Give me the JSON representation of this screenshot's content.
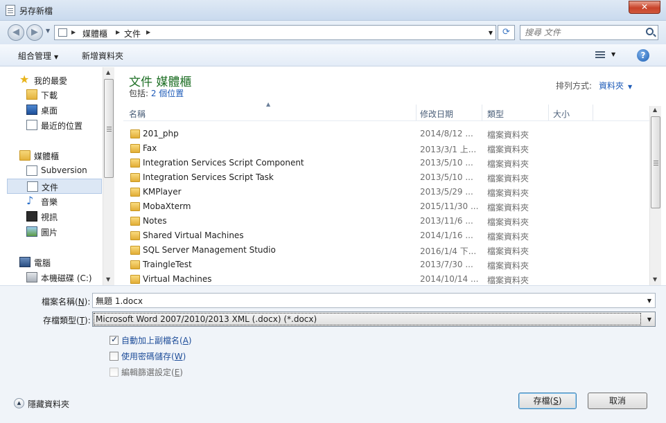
{
  "window": {
    "title": "另存新檔",
    "close_label": "✕"
  },
  "address": {
    "crumbs": [
      "媒體櫃",
      "文件"
    ],
    "search_placeholder": "搜尋 文件"
  },
  "toolbar": {
    "organize_label": "組合管理",
    "new_folder_label": "新增資料夾",
    "help_label": "?"
  },
  "nav": {
    "favorites": {
      "label": "我的最愛",
      "items": [
        {
          "label": "下載",
          "icon": "download-folder-icon"
        },
        {
          "label": "桌面",
          "icon": "desktop-icon"
        },
        {
          "label": "最近的位置",
          "icon": "recent-places-icon"
        }
      ]
    },
    "libraries": {
      "label": "媒體櫃",
      "items": [
        {
          "label": "Subversion",
          "icon": "document-library-icon"
        },
        {
          "label": "文件",
          "icon": "document-library-icon",
          "selected": true
        },
        {
          "label": "音樂",
          "icon": "music-icon"
        },
        {
          "label": "視訊",
          "icon": "video-icon"
        },
        {
          "label": "圖片",
          "icon": "picture-icon"
        }
      ]
    },
    "computer": {
      "label": "電腦",
      "items": [
        {
          "label": "本機磁碟 (C:)",
          "icon": "drive-icon"
        }
      ]
    }
  },
  "library": {
    "title": "文件 媒體櫃",
    "includes_prefix": "包括: ",
    "includes_link": "2 個位置",
    "arrange_label": "排列方式:",
    "arrange_value": "資料夾"
  },
  "columns": {
    "name": "名稱",
    "date": "修改日期",
    "type": "類型",
    "size": "大小"
  },
  "files": [
    {
      "name": "201_php",
      "date": "2014/8/12 ...",
      "type": "檔案資料夾"
    },
    {
      "name": "Fax",
      "date": "2013/3/1 上...",
      "type": "檔案資料夾"
    },
    {
      "name": "Integration Services Script Component",
      "date": "2013/5/10 ...",
      "type": "檔案資料夾"
    },
    {
      "name": "Integration Services Script Task",
      "date": "2013/5/10 ...",
      "type": "檔案資料夾"
    },
    {
      "name": "KMPlayer",
      "date": "2013/5/29 ...",
      "type": "檔案資料夾"
    },
    {
      "name": "MobaXterm",
      "date": "2015/11/30 ...",
      "type": "檔案資料夾"
    },
    {
      "name": "Notes",
      "date": "2013/11/6 ...",
      "type": "檔案資料夾"
    },
    {
      "name": "Shared Virtual Machines",
      "date": "2014/1/16 ...",
      "type": "檔案資料夾"
    },
    {
      "name": "SQL Server Management Studio",
      "date": "2016/1/4 下...",
      "type": "檔案資料夾"
    },
    {
      "name": "TraingleTest",
      "date": "2013/7/30 ...",
      "type": "檔案資料夾"
    },
    {
      "name": "Virtual Machines",
      "date": "2014/10/14 ...",
      "type": "檔案資料夾"
    }
  ],
  "form": {
    "filename_label": "檔案名稱(",
    "filename_key": "N",
    "filename_label_end": "):",
    "filename_value": "無題 1.docx",
    "filetype_label": "存檔類型(",
    "filetype_key": "T",
    "filetype_label_end": "):",
    "filetype_value": "Microsoft Word 2007/2010/2013 XML (.docx) (*.docx)",
    "checkboxes": [
      {
        "label": "自動加上副檔名(",
        "key": "A",
        "end": ")",
        "checked": true,
        "enabled": true
      },
      {
        "label": "使用密碼儲存(",
        "key": "W",
        "end": ")",
        "checked": false,
        "enabled": true
      },
      {
        "label": "編輯篩選設定(",
        "key": "E",
        "end": ")",
        "checked": false,
        "enabled": false
      }
    ]
  },
  "footer": {
    "hide_folders_label": "隱藏資料夾",
    "save_label": "存檔(",
    "save_key": "S",
    "save_end": ")",
    "cancel_label": "取消"
  }
}
